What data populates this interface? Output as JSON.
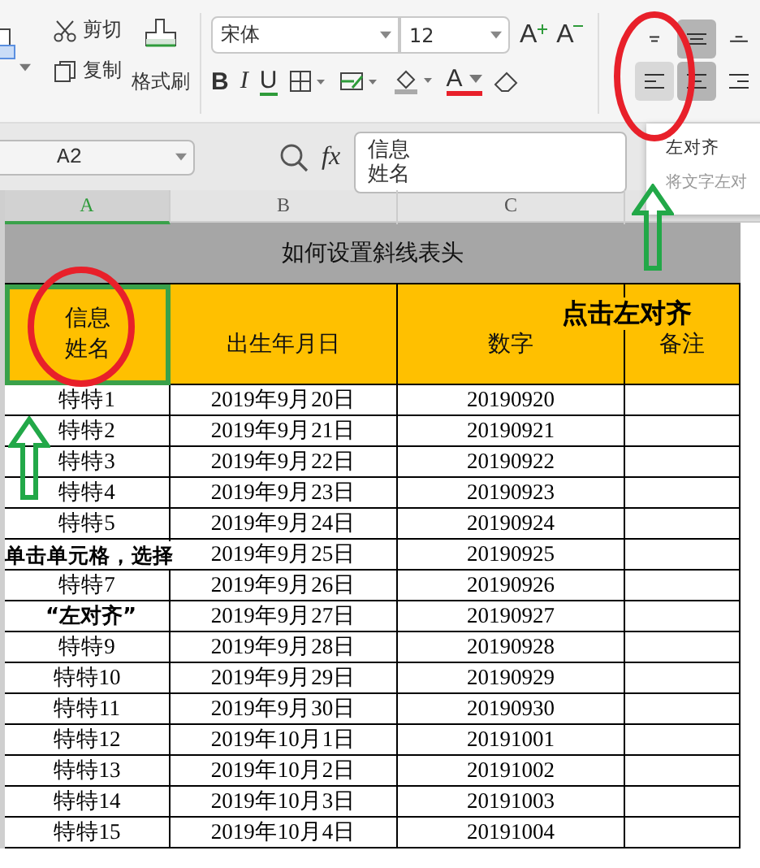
{
  "ribbon": {
    "clipboard": [
      {
        "kind": "cut",
        "label": "剪切"
      },
      {
        "kind": "copy",
        "label": "复制"
      }
    ],
    "format_painter": "格式刷",
    "font": {
      "name": "宋体",
      "size": "12"
    },
    "font_tools": [
      {
        "kind": "grow",
        "label": "A"
      },
      {
        "kind": "shrink",
        "label": "A"
      }
    ],
    "style_tools": [
      {
        "kind": "bold",
        "label": "B"
      },
      {
        "kind": "italic",
        "label": "I"
      },
      {
        "kind": "underline",
        "label": "U"
      },
      {
        "kind": "border"
      },
      {
        "kind": "fill"
      },
      {
        "kind": "color",
        "label": "A"
      },
      {
        "kind": "eraser"
      }
    ],
    "alignment": [
      {
        "kind": "top",
        "selected": false,
        "hovered": false
      },
      {
        "kind": "middle",
        "selected": true,
        "hovered": false
      },
      {
        "kind": "bottom",
        "selected": false,
        "hovered": false
      },
      {
        "kind": "left",
        "selected": false,
        "hovered": true
      },
      {
        "kind": "center",
        "selected": true,
        "hovered": false
      },
      {
        "kind": "right",
        "selected": false,
        "hovered": false
      }
    ]
  },
  "tooltip": {
    "title": "左对齐",
    "description": "将文字左对"
  },
  "formula_bar": {
    "cell": "A2",
    "function_label": "fx",
    "value_lines": [
      "信息",
      "姓名"
    ]
  },
  "column_headers": [
    {
      "label": "A",
      "selected": true
    },
    {
      "label": "B",
      "selected": false
    },
    {
      "label": "C",
      "selected": false
    }
  ],
  "table": {
    "title": "如何设置斜线表头",
    "headers": [
      {
        "lines": [
          "信息",
          "姓名"
        ],
        "selected": true
      },
      {
        "lines": [
          "出生年月日"
        ],
        "selected": false
      },
      {
        "lines": [
          "数字"
        ],
        "selected": false
      },
      {
        "lines": [
          "备注"
        ],
        "selected": false
      }
    ],
    "rows": [
      {
        "name": "特特1",
        "date": "2019年9月20日",
        "number": "20190920"
      },
      {
        "name": "特特2",
        "date": "2019年9月21日",
        "number": "20190921"
      },
      {
        "name": "特特3",
        "date": "2019年9月22日",
        "number": "20190922"
      },
      {
        "name": "特特4",
        "date": "2019年9月23日",
        "number": "20190923"
      },
      {
        "name": "特特5",
        "date": "2019年9月24日",
        "number": "20190924"
      },
      {
        "date": "2019年9月25日",
        "number": "20190925"
      },
      {
        "name": "特特7",
        "date": "2019年9月26日",
        "number": "20190926"
      },
      {
        "date": "2019年9月27日",
        "number": "20190927"
      },
      {
        "name": "特特9",
        "date": "2019年9月28日",
        "number": "20190928"
      },
      {
        "name": "特特10",
        "date": "2019年9月29日",
        "number": "20190929"
      },
      {
        "name": "特特11",
        "date": "2019年9月30日",
        "number": "20190930"
      },
      {
        "name": "特特12",
        "date": "2019年10月1日",
        "number": "20191001"
      },
      {
        "name": "特特13",
        "date": "2019年10月2日",
        "number": "20191002"
      },
      {
        "name": "特特14",
        "date": "2019年10月3日",
        "number": "20191003"
      },
      {
        "name": "特特15",
        "date": "2019年10月4日",
        "number": "20191004"
      }
    ]
  },
  "annotations": [
    {
      "kind": "header",
      "text": "点击左对齐"
    },
    {
      "kind": "cell",
      "text": "单击单元格，选择"
    },
    {
      "kind": "quote",
      "text": "“左对齐”"
    }
  ]
}
